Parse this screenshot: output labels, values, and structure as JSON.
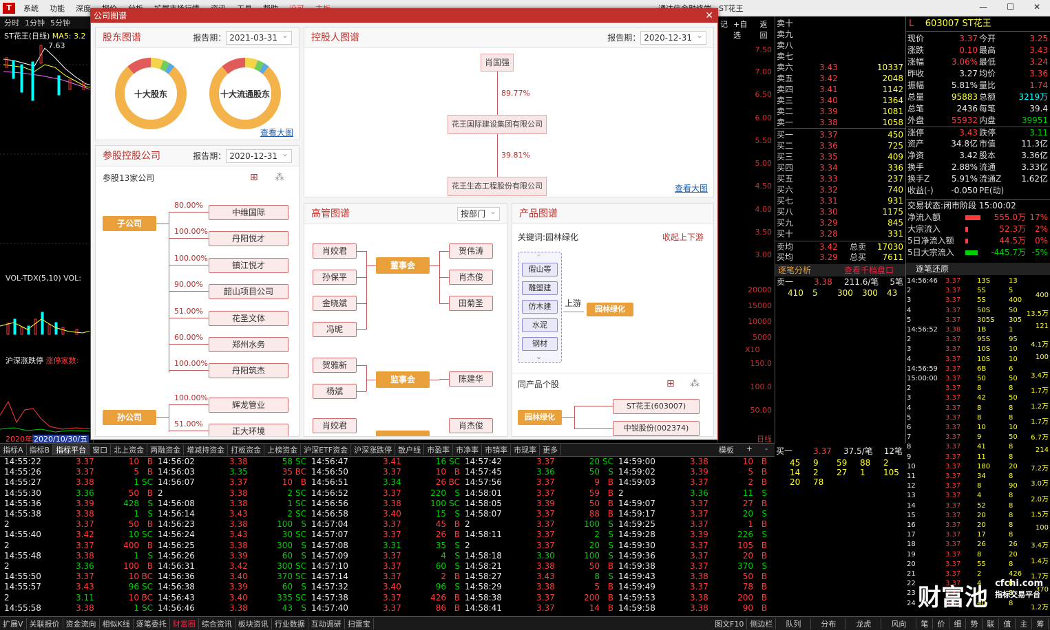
{
  "menubar": {
    "items": [
      "系统",
      "功能",
      "深度",
      "报价",
      "分析",
      "扩展市场行情",
      "资讯",
      "工具",
      "帮助",
      "没可",
      "主板"
    ],
    "title": "通达信金融终端 - ST花王",
    "logo": "T"
  },
  "chart_left": {
    "tabs": [
      "分时",
      "1分钟",
      "5分钟"
    ],
    "stock_label": "ST花王(日线)",
    "ma": "MA5: 3.2",
    "high_label": "7.63",
    "vol_label": "VOL-TDX(5,10) VOL:",
    "index_label": "沪深涨跌停",
    "index_sub": "涨停家数:",
    "date_axis": "2020年",
    "date_cursor": "2020/10/30/五"
  },
  "right_scale": {
    "top_icons": [
      "记",
      "+自选",
      "返回"
    ],
    "price_labels": [
      "7.50",
      "7.00",
      "6.50",
      "6.00",
      "5.50",
      "5.00",
      "4.50",
      "4.00",
      "3.50",
      "3.00"
    ],
    "vol_labels": [
      "20000",
      "15000",
      "10000",
      "5000",
      "X10"
    ],
    "idx_labels": [
      "150.0",
      "100.0",
      "50.00"
    ],
    "bottom_label": "日线"
  },
  "orderbook": {
    "asks": [
      {
        "label": "卖十",
        "price": "",
        "vol": ""
      },
      {
        "label": "卖九",
        "price": "",
        "vol": ""
      },
      {
        "label": "卖八",
        "price": "",
        "vol": ""
      },
      {
        "label": "卖七",
        "price": "",
        "vol": ""
      },
      {
        "label": "卖六",
        "price": "3.43",
        "vol": "10337"
      },
      {
        "label": "卖五",
        "price": "3.42",
        "vol": "2048"
      },
      {
        "label": "卖四",
        "price": "3.41",
        "vol": "1142"
      },
      {
        "label": "卖三",
        "price": "3.40",
        "vol": "1364"
      },
      {
        "label": "卖二",
        "price": "3.39",
        "vol": "1081"
      },
      {
        "label": "卖一",
        "price": "3.38",
        "vol": "1058"
      }
    ],
    "bids": [
      {
        "label": "买一",
        "price": "3.37",
        "vol": "450"
      },
      {
        "label": "买二",
        "price": "3.36",
        "vol": "725"
      },
      {
        "label": "买三",
        "price": "3.35",
        "vol": "409"
      },
      {
        "label": "买四",
        "price": "3.34",
        "vol": "336"
      },
      {
        "label": "买五",
        "price": "3.33",
        "vol": "237"
      },
      {
        "label": "买六",
        "price": "3.32",
        "vol": "740"
      },
      {
        "label": "买七",
        "price": "3.31",
        "vol": "931"
      },
      {
        "label": "买八",
        "price": "3.30",
        "vol": "1175"
      },
      {
        "label": "买九",
        "price": "3.29",
        "vol": "845"
      },
      {
        "label": "买十",
        "price": "3.28",
        "vol": "331"
      }
    ],
    "avg_sell": {
      "label": "卖均",
      "price": "3.42",
      "tag": "总卖",
      "vol": "17030"
    },
    "avg_buy": {
      "label": "买均",
      "price": "3.29",
      "tag": "总买",
      "vol": "7611"
    },
    "analysis_label": "逐笔分析",
    "analysis_link": "查看千档盘口",
    "sell1_line": {
      "label": "卖一",
      "price": "3.38",
      "amt": "211.6/笔",
      "count": "5笔"
    },
    "sell1_vals": [
      "410",
      "5",
      "300",
      "300",
      "43"
    ],
    "buy1_line": {
      "label": "买一",
      "price": "3.37",
      "amt": "37.5/笔",
      "count": "12笔"
    },
    "buy1_vals": [
      [
        "45",
        "9",
        "59",
        "88",
        "2"
      ],
      [
        "14",
        "2",
        "27",
        "1",
        "105"
      ],
      [
        "20",
        "78",
        "",
        "",
        ""
      ]
    ]
  },
  "info": {
    "header": "603007 ST花王",
    "header_mark": "L",
    "rows": [
      {
        "a": "现价",
        "av": "3.37",
        "b": "今开",
        "bv": "3.25",
        "ac": "red",
        "bc": "red"
      },
      {
        "a": "涨跌",
        "av": "0.10",
        "b": "最高",
        "bv": "3.43",
        "ac": "red",
        "bc": "red"
      },
      {
        "a": "涨幅",
        "av": "3.06%",
        "b": "最低",
        "bv": "3.24",
        "ac": "red",
        "bc": "red"
      },
      {
        "a": "昨收",
        "av": "3.27",
        "b": "均价",
        "bv": "3.36",
        "ac": "white",
        "bc": "red"
      },
      {
        "a": "振幅",
        "av": "5.81%",
        "b": "量比",
        "bv": "1.74",
        "ac": "white",
        "bc": "red"
      },
      {
        "a": "总量",
        "av": "95883",
        "b": "总额",
        "bv": "3219万",
        "ac": "yellow",
        "bc": "cyan"
      },
      {
        "a": "总笔",
        "av": "2436",
        "b": "每笔",
        "bv": "39.4",
        "ac": "white",
        "bc": "white"
      },
      {
        "a": "外盘",
        "av": "55932",
        "b": "内盘",
        "bv": "39951",
        "ac": "red",
        "bc": "green"
      },
      {
        "a": "涨停",
        "av": "3.43",
        "b": "跌停",
        "bv": "3.11",
        "ac": "red",
        "bc": "green"
      },
      {
        "a": "资产",
        "av": "34.8亿",
        "b": "市值",
        "bv": "11.3亿",
        "ac": "white",
        "bc": "white"
      },
      {
        "a": "净资",
        "av": "3.42",
        "b": "股本",
        "bv": "3.36亿",
        "ac": "white",
        "bc": "white"
      },
      {
        "a": "换手",
        "av": "2.88%",
        "b": "流通",
        "bv": "3.33亿",
        "ac": "white",
        "bc": "white"
      },
      {
        "a": "换手Z",
        "av": "5.91%",
        "b": "流通Z",
        "bv": "1.62亿",
        "ac": "white",
        "bc": "white"
      },
      {
        "a": "收益(-)",
        "av": "-0.050",
        "b": "PE(动)",
        "bv": "",
        "ac": "white",
        "bc": "white"
      }
    ],
    "status": "交易状态:闭市阶段 15:00:02",
    "flows": [
      {
        "a": "净流入额",
        "v": "555.0万",
        "p": "17%",
        "c": "red"
      },
      {
        "a": "大宗流入",
        "v": "52.3万",
        "p": "2%",
        "c": "red"
      },
      {
        "a": "5日净流入额",
        "v": "44.5万",
        "p": "0%",
        "c": "red"
      },
      {
        "a": "5日大宗流入",
        "v": "-445.7万",
        "p": "-5%",
        "c": "green"
      }
    ],
    "zhubi_label": "逐笔还原"
  },
  "tickbar": {
    "items": [
      "指标A",
      "指标B",
      "指标平台",
      "窗口",
      "北上资金",
      "两融资金",
      "增减持资金",
      "打板资金",
      "上榜资金",
      "沪深ETF资金",
      "沪深涨跌停",
      "散户线",
      "市盈率",
      "市净率",
      "市销率",
      "市现率",
      "更多"
    ],
    "active_index": 2,
    "right": [
      "模板",
      "+",
      "-"
    ]
  },
  "ticks": {
    "columns": [
      [
        [
          "14:55:22",
          "3.37",
          "10",
          "B"
        ],
        [
          "14:55:26",
          "3.37",
          "5",
          "B"
        ],
        [
          "14:55:27",
          "3.38",
          "1",
          "SC"
        ],
        [
          "14:55:30",
          "3.36",
          "50",
          "B"
        ],
        [
          "14:55:36",
          "3.39",
          "428",
          "S"
        ],
        [
          "14:55:38",
          "3.38",
          "1",
          "S"
        ],
        [
          "2",
          "3.37",
          "50",
          "B"
        ],
        [
          "14:55:40",
          "3.42",
          "10",
          "SC"
        ],
        [
          "2",
          "3.37",
          "400",
          "B"
        ],
        [
          "14:55:48",
          "3.38",
          "1",
          "S"
        ],
        [
          "2",
          "3.36",
          "100",
          "B"
        ],
        [
          "14:55:50",
          "3.37",
          "10",
          "BC"
        ],
        [
          "14:55:57",
          "3.43",
          "96",
          "SC"
        ],
        [
          "2",
          "3.11",
          "10",
          "BC"
        ],
        [
          "14:55:58",
          "3.38",
          "1",
          "SC"
        ]
      ],
      [
        [
          "14:56:02",
          "3.38",
          "58",
          "SC"
        ],
        [
          "14:56:03",
          "3.35",
          "35",
          "BC"
        ],
        [
          "14:56:07",
          "3.37",
          "10",
          "B"
        ],
        [
          "2",
          "3.38",
          "2",
          "SC"
        ],
        [
          "14:56:08",
          "3.38",
          "1",
          "SC"
        ],
        [
          "14:56:14",
          "3.43",
          "2",
          "SC"
        ],
        [
          "14:56:23",
          "3.38",
          "100",
          "S"
        ],
        [
          "14:56:24",
          "3.43",
          "30",
          "SC"
        ],
        [
          "14:56:25",
          "3.38",
          "300",
          "S"
        ],
        [
          "14:56:26",
          "3.39",
          "60",
          "S"
        ],
        [
          "14:56:31",
          "3.42",
          "300",
          "SC"
        ],
        [
          "14:56:36",
          "3.40",
          "370",
          "SC"
        ],
        [
          "14:56:38",
          "3.39",
          "60",
          "S"
        ],
        [
          "14:56:43",
          "3.40",
          "335",
          "SC"
        ],
        [
          "14:56:46",
          "3.38",
          "43",
          "S"
        ]
      ],
      [
        [
          "14:56:47",
          "3.41",
          "16",
          "SC"
        ],
        [
          "14:56:50",
          "3.37",
          "10",
          "B"
        ],
        [
          "14:56:51",
          "3.34",
          "26",
          "BC"
        ],
        [
          "14:56:52",
          "3.37",
          "220",
          "S"
        ],
        [
          "14:56:56",
          "3.38",
          "100",
          "SC"
        ],
        [
          "14:56:58",
          "3.40",
          "15",
          "S"
        ],
        [
          "14:57:04",
          "3.37",
          "45",
          "B"
        ],
        [
          "14:57:07",
          "3.37",
          "26",
          "B"
        ],
        [
          "14:57:08",
          "3.31",
          "35",
          "S"
        ],
        [
          "14:57:09",
          "3.37",
          "4",
          "S"
        ],
        [
          "14:57:10",
          "3.37",
          "60",
          "S"
        ],
        [
          "14:57:14",
          "3.37",
          "2",
          "B"
        ],
        [
          "14:57:32",
          "3.40",
          "96",
          "S"
        ],
        [
          "14:57:38",
          "3.37",
          "426",
          "B"
        ],
        [
          "14:57:40",
          "3.37",
          "86",
          "B"
        ]
      ],
      [
        [
          "14:57:42",
          "3.37",
          "20",
          "SC"
        ],
        [
          "14:57:45",
          "3.36",
          "50",
          "S"
        ],
        [
          "14:57:56",
          "3.37",
          "9",
          "B"
        ],
        [
          "14:58:01",
          "3.37",
          "59",
          "B"
        ],
        [
          "14:58:05",
          "3.39",
          "50",
          "B"
        ],
        [
          "14:58:07",
          "3.37",
          "88",
          "B"
        ],
        [
          "2",
          "3.37",
          "100",
          "S"
        ],
        [
          "14:58:11",
          "3.37",
          "2",
          "S"
        ],
        [
          "2",
          "3.37",
          "20",
          "S"
        ],
        [
          "14:58:18",
          "3.30",
          "100",
          "S"
        ],
        [
          "14:58:21",
          "3.38",
          "50",
          "B"
        ],
        [
          "14:58:27",
          "3.43",
          "8",
          "S"
        ],
        [
          "14:58:29",
          "3.38",
          "5",
          "B"
        ],
        [
          "14:58:38",
          "3.37",
          "200",
          "B"
        ],
        [
          "14:58:41",
          "3.37",
          "14",
          "B"
        ]
      ],
      [
        [
          "14:59:00",
          "3.38",
          "10",
          "B"
        ],
        [
          "14:59:02",
          "3.39",
          "5",
          "B"
        ],
        [
          "14:59:03",
          "3.37",
          "2",
          "B"
        ],
        [
          "2",
          "3.36",
          "11",
          "S"
        ],
        [
          "14:59:07",
          "3.37",
          "27",
          "B"
        ],
        [
          "14:59:17",
          "3.37",
          "20",
          "S"
        ],
        [
          "14:59:25",
          "3.37",
          "1",
          "B"
        ],
        [
          "14:59:28",
          "3.39",
          "226",
          "S"
        ],
        [
          "14:59:30",
          "3.37",
          "105",
          "B"
        ],
        [
          "14:59:36",
          "3.37",
          "20",
          "B"
        ],
        [
          "14:59:38",
          "3.37",
          "370",
          "S"
        ],
        [
          "14:59:43",
          "3.38",
          "50",
          "B"
        ],
        [
          "14:59:49",
          "3.37",
          "78",
          "B"
        ],
        [
          "14:59:53",
          "3.38",
          "200",
          "B"
        ],
        [
          "14:59:58",
          "3.38",
          "90",
          "B"
        ]
      ]
    ]
  },
  "zhubi": {
    "rows": [
      [
        "14:56:46",
        "3.37",
        "13S",
        "13"
      ],
      [
        "2",
        "3.37",
        "5S",
        "5"
      ],
      [
        "3",
        "3.37",
        "5S",
        "400"
      ],
      [
        "4",
        "3.37",
        "50S",
        "50"
      ],
      [
        "5",
        "3.37",
        "305S",
        "305"
      ],
      [
        "14:56:52",
        "3.38",
        "1B",
        "1"
      ],
      [
        "2",
        "3.37",
        "95S",
        "95"
      ],
      [
        "3",
        "3.37",
        "10S",
        "10"
      ],
      [
        "4",
        "3.37",
        "10S",
        "10"
      ],
      [
        "14:56:59",
        "3.37",
        "6B",
        "6"
      ],
      [
        "15:00:00",
        "3.37",
        "50",
        "50"
      ],
      [
        "2",
        "3.37",
        "8",
        "8"
      ],
      [
        "3",
        "3.37",
        "42",
        "50"
      ],
      [
        "4",
        "3.37",
        "8",
        "8"
      ],
      [
        "5",
        "3.37",
        "8",
        "8"
      ],
      [
        "6",
        "3.37",
        "10",
        "10"
      ],
      [
        "7",
        "3.37",
        "9",
        "50"
      ],
      [
        "8",
        "3.37",
        "41",
        "8"
      ],
      [
        "9",
        "3.37",
        "11",
        "8"
      ],
      [
        "10",
        "3.37",
        "180",
        "20"
      ],
      [
        "11",
        "3.37",
        "34",
        "8"
      ],
      [
        "12",
        "3.37",
        "8",
        "90"
      ],
      [
        "13",
        "3.37",
        "4",
        "8"
      ],
      [
        "14",
        "3.37",
        "52",
        "8"
      ],
      [
        "15",
        "3.37",
        "20",
        "8"
      ],
      [
        "16",
        "3.37",
        "20",
        "8"
      ],
      [
        "17",
        "3.37",
        "17",
        "8"
      ],
      [
        "18",
        "3.37",
        "26",
        "26"
      ],
      [
        "19",
        "3.37",
        "8",
        "20"
      ],
      [
        "20",
        "3.37",
        "55",
        "8"
      ],
      [
        "21",
        "3.37",
        "2",
        "426"
      ],
      [
        "22",
        "3.37",
        "4",
        "8"
      ],
      [
        "23",
        "3.37",
        "6",
        "8"
      ],
      [
        "24",
        "3.37",
        "40",
        "8"
      ]
    ],
    "side": [
      "400",
      "13.5万",
      "121",
      "4.1万",
      "100",
      "3.4万",
      "1.7万",
      "1.2万",
      "1.7万",
      "6.7万",
      "214",
      "7.2万",
      "3.0万",
      "2.0万",
      "1.5万",
      "100",
      "3.4万",
      "1.4万",
      "1.7万",
      "370",
      "1.2万"
    ]
  },
  "bottombar": {
    "items": [
      "扩展V",
      "关联报价",
      "资金流向",
      "相似K线",
      "逐笔委托",
      "财富圈",
      "综合资讯",
      "板块资讯",
      "行业数据",
      "互动调研",
      "扫雷宝"
    ],
    "active_index": 5,
    "right": [
      "图文F10",
      "侧边栏",
      "队列",
      "分布",
      "龙虎",
      "风向",
      "笔",
      "价",
      "细",
      "势",
      "联",
      "值",
      "主",
      "筹"
    ]
  },
  "watermark": {
    "brand": "财富池",
    "url": "cfchi.com",
    "slogan": "指标交易平台"
  },
  "modal": {
    "title": "公司图谱",
    "shareholders": {
      "title": "股东图谱",
      "period_label": "报告期：",
      "period": "2021-03-31",
      "donut1": "十大股东",
      "donut2": "十大流通股东",
      "link": "查看大图"
    },
    "holdings": {
      "title": "参股控股公司",
      "period_label": "报告期：",
      "period": "2020-12-31",
      "count_label": "参股13家公司",
      "sub_label": "子公司",
      "grand_label": "孙公司",
      "subs": [
        {
          "pct": "80.00%",
          "name": "中维国际"
        },
        {
          "pct": "100.00%",
          "name": "丹阳悦才"
        },
        {
          "pct": "100.00%",
          "name": "镇江悦才"
        },
        {
          "pct": "90.00%",
          "name": "韶山项目公司"
        },
        {
          "pct": "51.00%",
          "name": "花圣文体"
        },
        {
          "pct": "60.00%",
          "name": "郑州水务"
        },
        {
          "pct": "100.00%",
          "name": "丹阳筑杰"
        }
      ],
      "grands": [
        {
          "pct": "100.00%",
          "name": "辉龙管业"
        },
        {
          "pct": "51.00%",
          "name": "正大环境"
        }
      ]
    },
    "controller": {
      "title": "控股人图谱",
      "period_label": "报告期：",
      "period": "2020-12-31",
      "nodes": [
        "肖国强",
        "花王国际建设集团有限公司",
        "花王生态工程股份有限公司"
      ],
      "pcts": [
        "89.77%",
        "39.81%"
      ],
      "link": "查看大图"
    },
    "execs": {
      "title": "高管图谱",
      "filter": "按部门",
      "board": "董事会",
      "board_left": [
        "肖姣君",
        "孙保平",
        "金晓斌",
        "冯昵"
      ],
      "board_right": [
        "贺伟涛",
        "肖杰俊",
        "田菊圣"
      ],
      "supervisors": "监事会",
      "sup_left": [
        "贺雅新",
        "杨斌"
      ],
      "sup_right": [
        "陈建华"
      ],
      "more_left": [
        "肖姣君"
      ],
      "more_right": [
        "肖杰俊"
      ]
    },
    "products": {
      "title": "产品图谱",
      "keyword": "关键词:园林绿化",
      "collapse": "收起上下游",
      "upstream_items": [
        "假山等建..",
        "雕塑建筑..",
        "仿木建筑..",
        "水泥",
        "钢材"
      ],
      "upstream_label": "上游",
      "product": "园林绿化",
      "peers_label": "同产品个股",
      "peer_root": "园林绿化",
      "peers": [
        "ST花王(603007)",
        "中锐股份(002374)"
      ]
    }
  }
}
